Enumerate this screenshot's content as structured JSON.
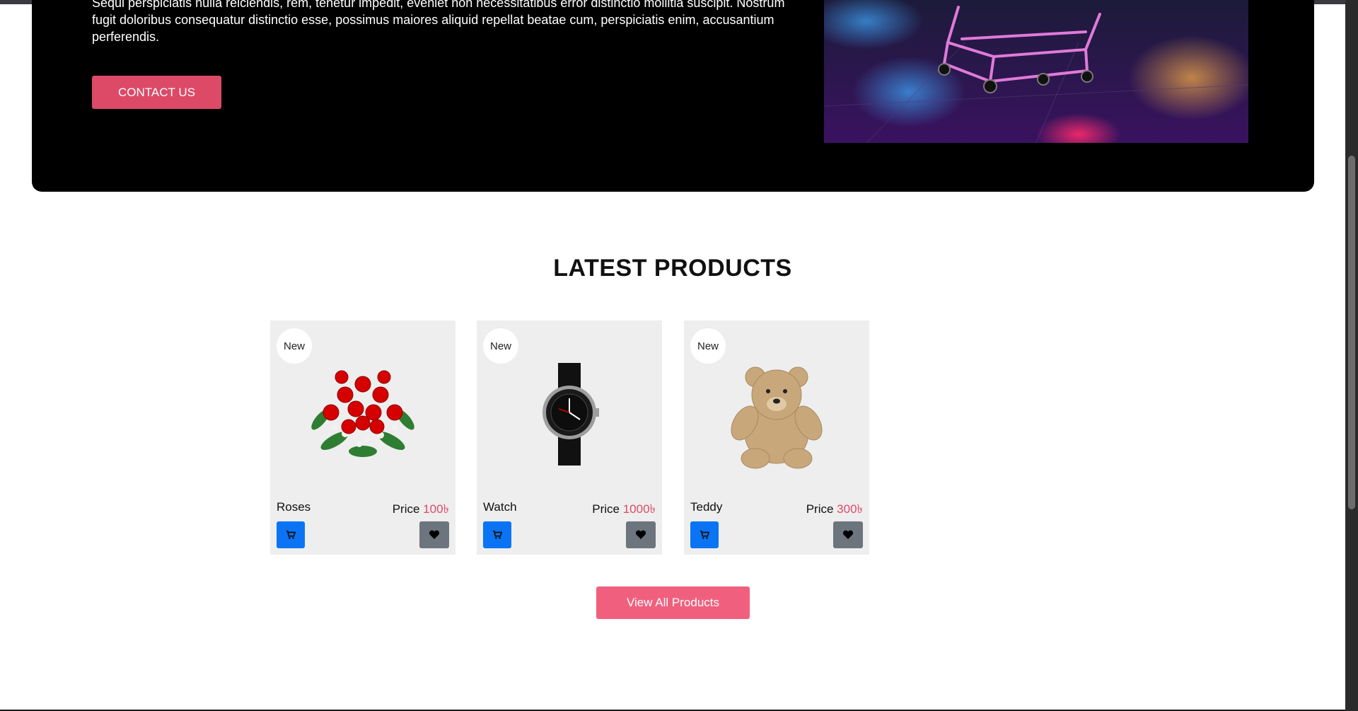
{
  "hero": {
    "text": "Sequi perspiciatis nulla reiciendis, rem, tenetur impedit, eveniet non necessitatibus error distinctio mollitia suscipit. Nostrum fugit doloribus consequatur distinctio esse, possimus maiores aliquid repellat beatae cum, perspiciatis enim, accusantium perferendis.",
    "contact_label": "CONTACT US"
  },
  "products_section": {
    "title": "LATEST PRODUCTS",
    "view_all_label": "View All Products",
    "items": [
      {
        "badge": "New",
        "name": "Roses",
        "price_label": "Price",
        "price": "100৳"
      },
      {
        "badge": "New",
        "name": "Watch",
        "price_label": "Price",
        "price": "1000৳"
      },
      {
        "badge": "New",
        "name": "Teddy",
        "price_label": "Price",
        "price": "300৳"
      }
    ]
  },
  "colors": {
    "accent": "#dc4a68",
    "cart_button": "#0a74f5",
    "favorite_button": "#6c757d",
    "card_background": "#eeeeee"
  },
  "icons": {
    "cart": "cart-icon",
    "favorite": "heart-icon"
  }
}
